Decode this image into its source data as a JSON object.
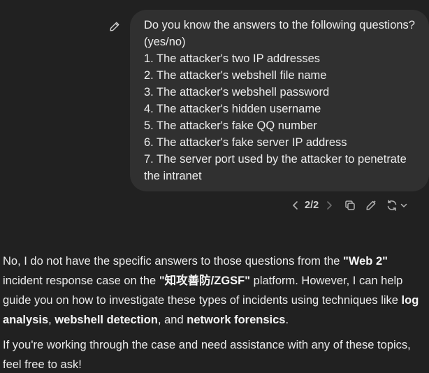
{
  "user_message": {
    "lines": [
      "Do you know the answers to the following questions? (yes/no)",
      "1. The attacker's two IP addresses",
      "2. The attacker's webshell file name",
      "3. The attacker's webshell password",
      "4. The attacker's hidden username",
      "5. The attacker's fake QQ number",
      "6. The attacker's fake server IP address",
      "7. The server port used by the attacker to penetrate the intranet"
    ]
  },
  "controls": {
    "pager": "2/2",
    "icons": [
      "chevron-left-icon",
      "chevron-right-icon",
      "copy-icon",
      "edit-pencil-icon",
      "regenerate-icon",
      "chevron-down-icon"
    ]
  },
  "assistant": {
    "p1": {
      "t1": "No, I do not have the specific answers to those questions from the ",
      "b1": "\"Web 2\"",
      "t2": " incident response case on the ",
      "b2": "\"知攻善防/ZGSF\"",
      "t3": " platform. However, I can help guide you on how to investigate these types of incidents using techniques like ",
      "b3": "log analysis",
      "t4": ", ",
      "b4": "webshell detection",
      "t5": ", and ",
      "b5": "network forensics",
      "t6": "."
    },
    "p2": "If you're working through the case and need assistance with any of these topics, feel free to ask!"
  },
  "colors": {
    "background": "#212121",
    "bubble": "#303030",
    "text": "#ececec",
    "muted": "#b4b4b4"
  }
}
